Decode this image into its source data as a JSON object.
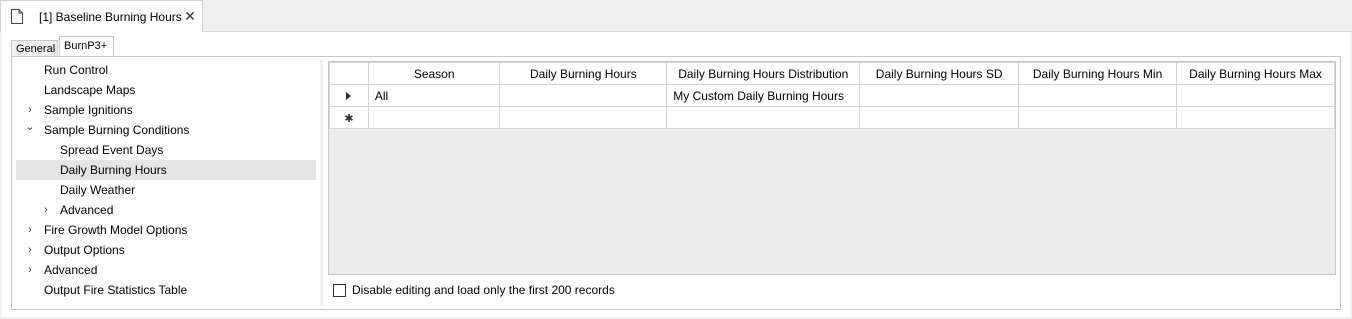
{
  "document_tab": {
    "title": "[1] Baseline Burning Hours",
    "icon": "document-icon",
    "close_glyph": "✕"
  },
  "inner_tabs": [
    {
      "label": "General"
    },
    {
      "label": "BurnP3+"
    }
  ],
  "tree": {
    "items": [
      {
        "label": "Run Control",
        "expander": ""
      },
      {
        "label": "Landscape Maps",
        "expander": ""
      },
      {
        "label": "Sample Ignitions",
        "expander": "›"
      },
      {
        "label": "Sample Burning Conditions",
        "expander": "⌄"
      },
      {
        "label": "Spread Event Days",
        "expander": ""
      },
      {
        "label": "Daily Burning Hours",
        "expander": "",
        "selected": true
      },
      {
        "label": "Daily Weather",
        "expander": ""
      },
      {
        "label": "Advanced",
        "expander": "›"
      },
      {
        "label": "Fire Growth Model Options",
        "expander": "›"
      },
      {
        "label": "Output Options",
        "expander": "›"
      },
      {
        "label": "Advanced",
        "expander": "›"
      },
      {
        "label": "Output Fire Statistics Table",
        "expander": ""
      }
    ]
  },
  "grid": {
    "columns": [
      "Season",
      "Daily Burning Hours",
      "Daily Burning Hours Distribution",
      "Daily Burning Hours SD",
      "Daily Burning Hours Min",
      "Daily Burning Hours Max"
    ],
    "rows": [
      {
        "marker": "current-row-arrow",
        "cells": [
          "All",
          "",
          "My Custom Daily Burning Hours",
          "",
          "",
          ""
        ]
      },
      {
        "marker": "new-row-star",
        "cells": [
          "",
          "",
          "",
          "",
          "",
          ""
        ]
      }
    ],
    "new_row_glyph": "✱"
  },
  "checkbox": {
    "label": "Disable editing and load only the first 200 records",
    "checked": false
  }
}
